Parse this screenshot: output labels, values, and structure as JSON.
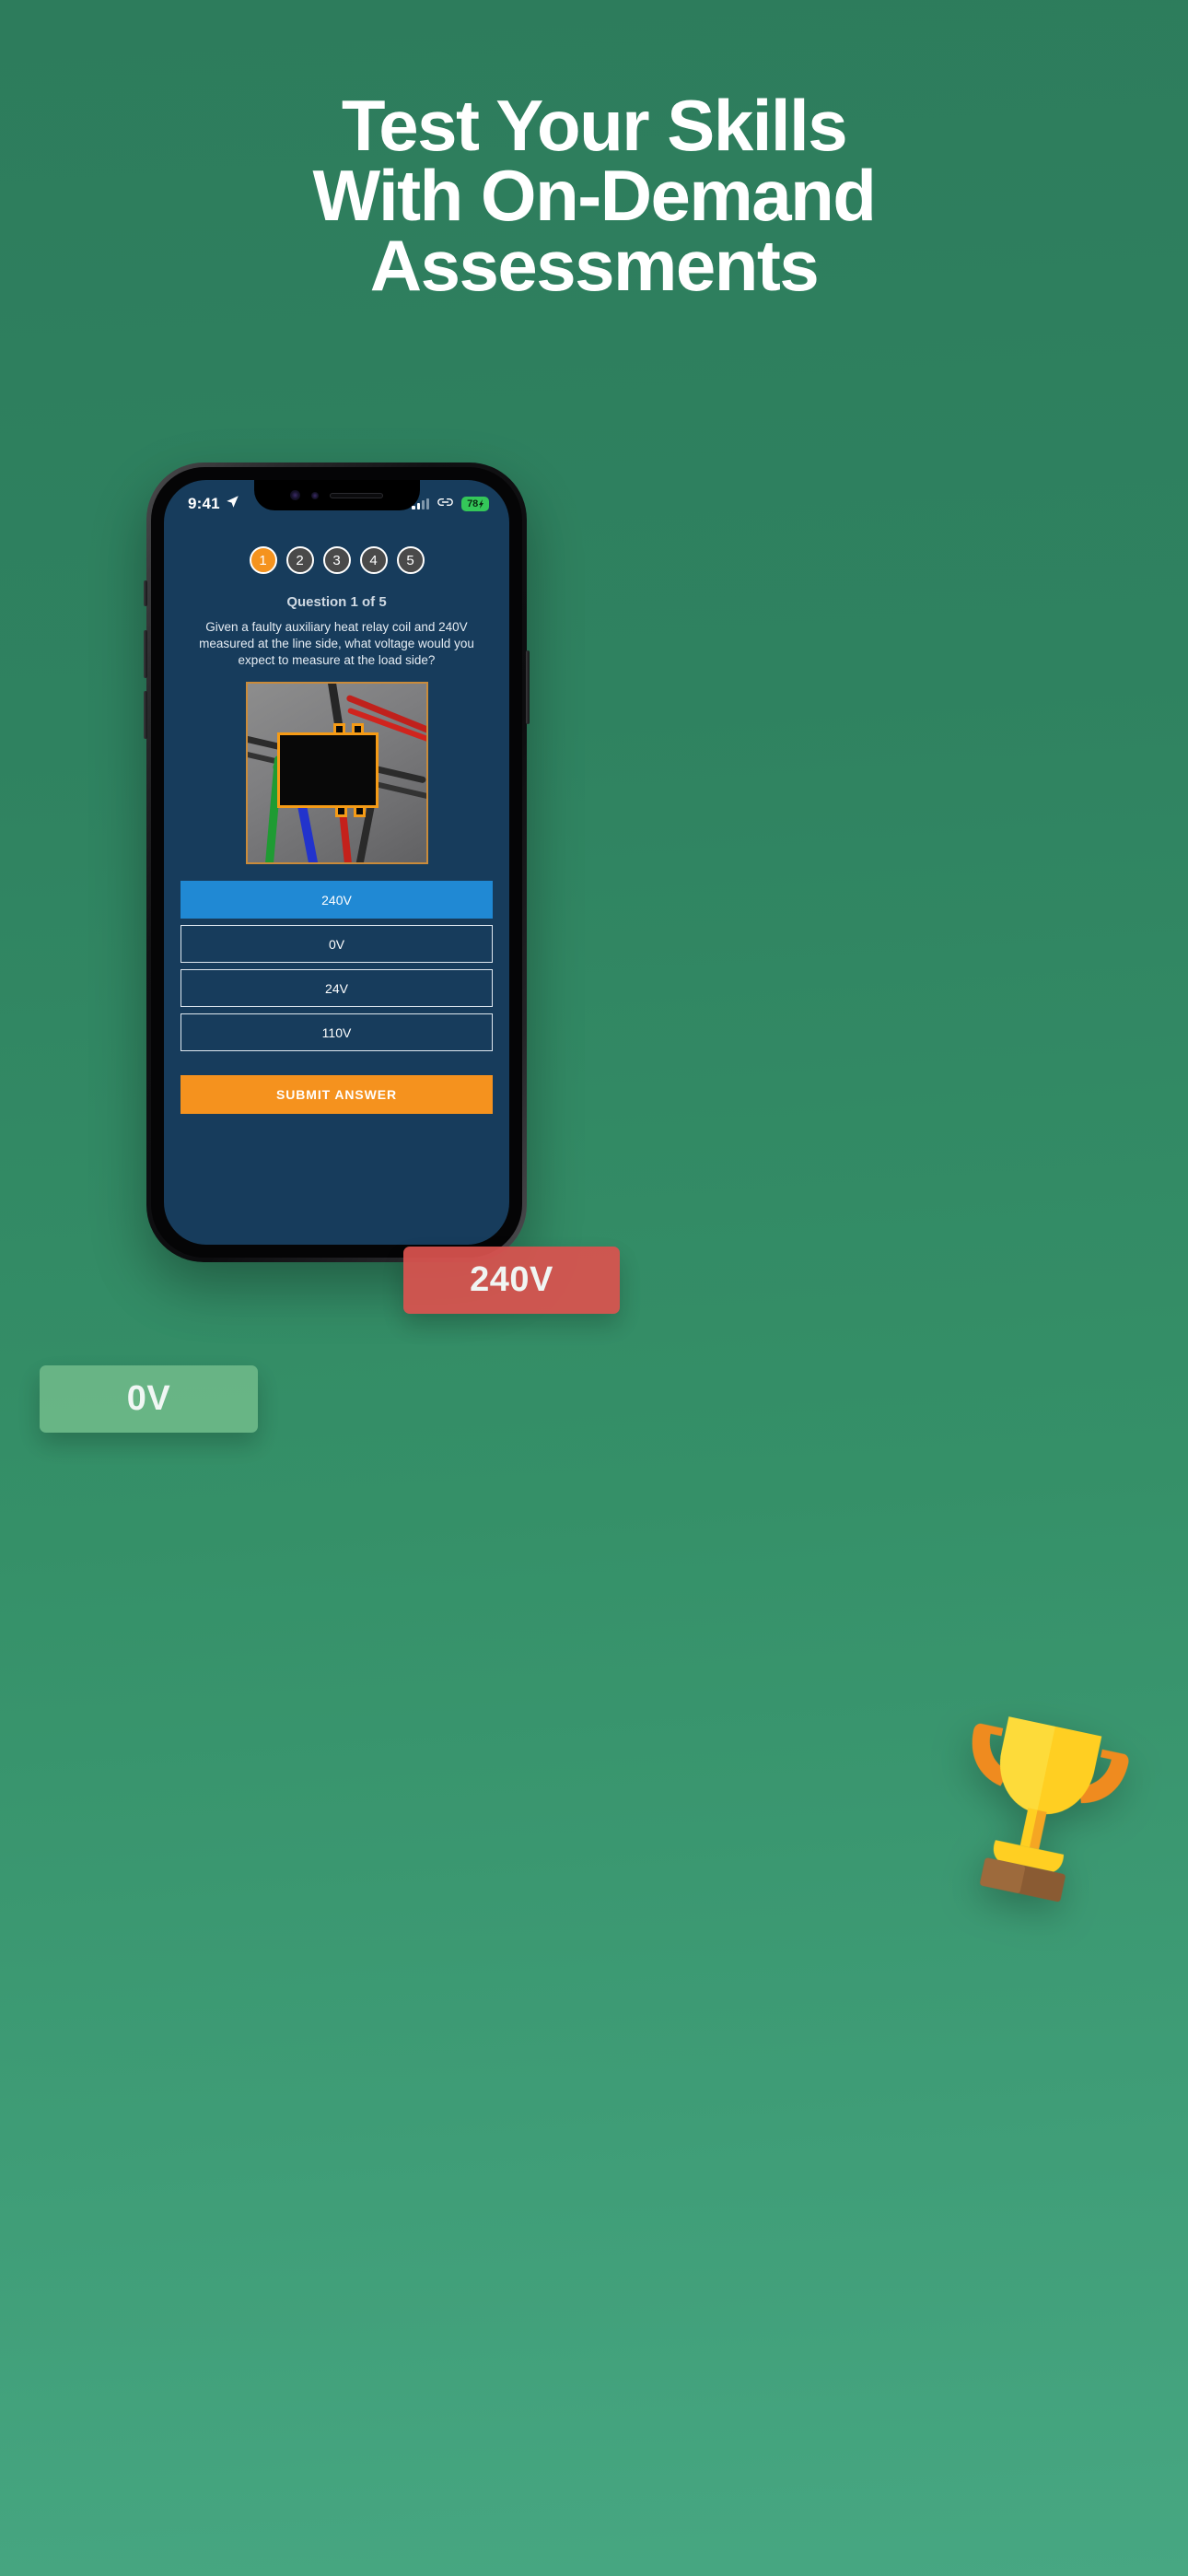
{
  "headline": {
    "line1": "Test Your Skills",
    "line2": "With On-Demand",
    "line3": "Assessments"
  },
  "phone": {
    "status_bar": {
      "time": "9:41",
      "location_icon": "location-arrow-icon",
      "signal_icon": "cellular-signal-icon",
      "link_icon": "link-chain-icon",
      "battery_level": "78",
      "battery_charging_icon": "bolt-icon"
    },
    "quiz": {
      "steps": [
        {
          "number": "1",
          "state": "active"
        },
        {
          "number": "2",
          "state": "inactive"
        },
        {
          "number": "3",
          "state": "inactive"
        },
        {
          "number": "4",
          "state": "inactive"
        },
        {
          "number": "5",
          "state": "inactive"
        }
      ],
      "progress_label": "Question 1 of 5",
      "question_text": "Given a faulty auxiliary heat relay coil and 240V measured at the line side, what voltage would you expect to measure at the load side?",
      "image_alt": "relay-wiring-photo",
      "options": [
        {
          "label": "240V",
          "selected": true
        },
        {
          "label": "0V",
          "selected": false
        },
        {
          "label": "24V",
          "selected": false
        },
        {
          "label": "110V",
          "selected": false
        }
      ],
      "submit_label": "SUBMIT ANSWER"
    }
  },
  "callouts": {
    "wrong": "240V",
    "correct": "0V"
  },
  "decor": {
    "trophy_icon": "trophy-icon"
  },
  "colors": {
    "background_top": "#2d7c5c",
    "background_bottom": "#47a782",
    "screen_bg": "#173c5c",
    "accent_orange": "#f5921e",
    "selected_blue": "#2089d4",
    "badge_red": "#d9534f",
    "badge_green": "#6cb888",
    "battery_green": "#34c759"
  }
}
